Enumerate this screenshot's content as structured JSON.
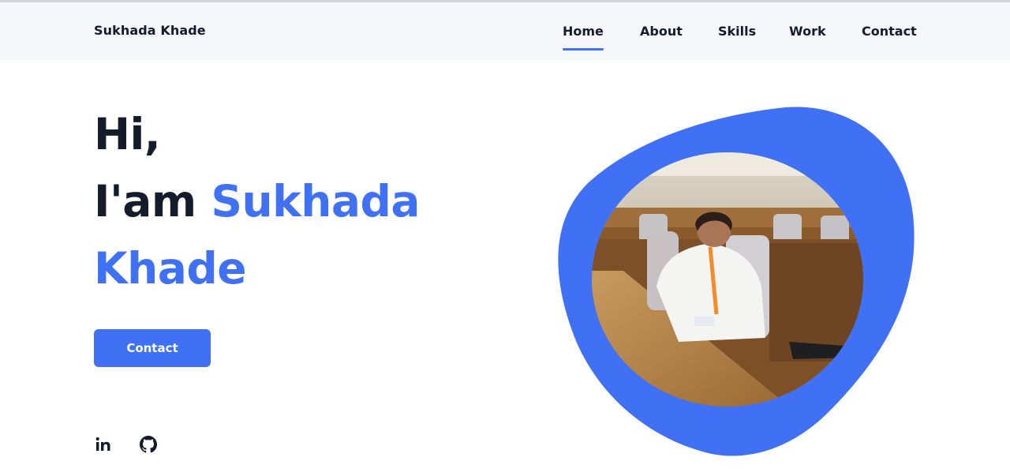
{
  "header": {
    "logo": "Sukhada Khade",
    "nav": [
      {
        "label": "Home",
        "active": true
      },
      {
        "label": "About",
        "active": false
      },
      {
        "label": "Skills",
        "active": false
      },
      {
        "label": "Work",
        "active": false
      },
      {
        "label": "Contact",
        "active": false
      }
    ]
  },
  "hero": {
    "greeting": "Hi,",
    "intro": "I'am",
    "first_name": "Sukhada",
    "last_name": "Khade",
    "button_label": "Contact",
    "photo_alt": "portrait",
    "socials": [
      {
        "icon": "linkedin-icon"
      },
      {
        "icon": "github-icon"
      }
    ]
  },
  "colors": {
    "accent": "#4070f4",
    "text": "#161b2b",
    "header_bg": "#f6f7fb"
  }
}
